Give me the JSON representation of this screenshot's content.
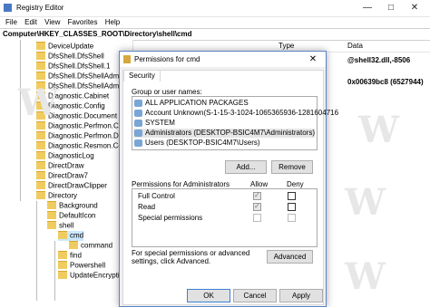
{
  "window": {
    "title": "Registry Editor",
    "minimize": "—",
    "maximize": "□",
    "close": "✕"
  },
  "menu": [
    "File",
    "Edit",
    "View",
    "Favorites",
    "Help"
  ],
  "address": "Computer\\HKEY_CLASSES_ROOT\\Directory\\shell\\cmd",
  "list": {
    "col_type": "Type",
    "col_data": "Data",
    "values": [
      "@shell32.dll,-8506",
      "0x00639bc8 (6527944)"
    ]
  },
  "tree": [
    "DeviceUpdate",
    "DfsShell.DfsShell",
    "DfsShell.DfsShell.1",
    "DfsShell.DfsShellAdmi",
    "DfsShell.DfsShellAdmi",
    "Diagnostic.Cabinet",
    "Diagnostic.Config",
    "Diagnostic.Document",
    "Diagnostic.Perfmon.Co",
    "Diagnostic.Perfmon.Do",
    "Diagnostic.Resmon.Co",
    "DiagnosticLog",
    "DirectDraw",
    "DirectDraw7",
    "DirectDrawClipper",
    "Directory",
    "Background",
    "DefaultIcon",
    "shell",
    "cmd",
    "command",
    "find",
    "Powershell",
    "UpdateEncryptio"
  ],
  "dialog": {
    "title": "Permissions for cmd",
    "close": "✕",
    "tab": "Security",
    "group_label": "Group or user names:",
    "groups": [
      "ALL APPLICATION PACKAGES",
      "Account Unknown(S-1-15-3-1024-1065365936-1281604716",
      "SYSTEM",
      "Administrators (DESKTOP-BSIC4M7\\Administrators)",
      "Users (DESKTOP-BSIC4M7\\Users)"
    ],
    "add": "Add...",
    "remove": "Remove",
    "perm_label": "Permissions for Administrators",
    "allow": "Allow",
    "deny": "Deny",
    "permissions": [
      {
        "name": "Full Control",
        "allow": true,
        "deny": false
      },
      {
        "name": "Read",
        "allow": true,
        "deny": false
      },
      {
        "name": "Special permissions",
        "allow": false,
        "deny": false
      }
    ],
    "advanced_text": "For special permissions or advanced settings, click Advanced.",
    "advanced": "Advanced",
    "ok": "OK",
    "cancel": "Cancel",
    "apply": "Apply"
  }
}
